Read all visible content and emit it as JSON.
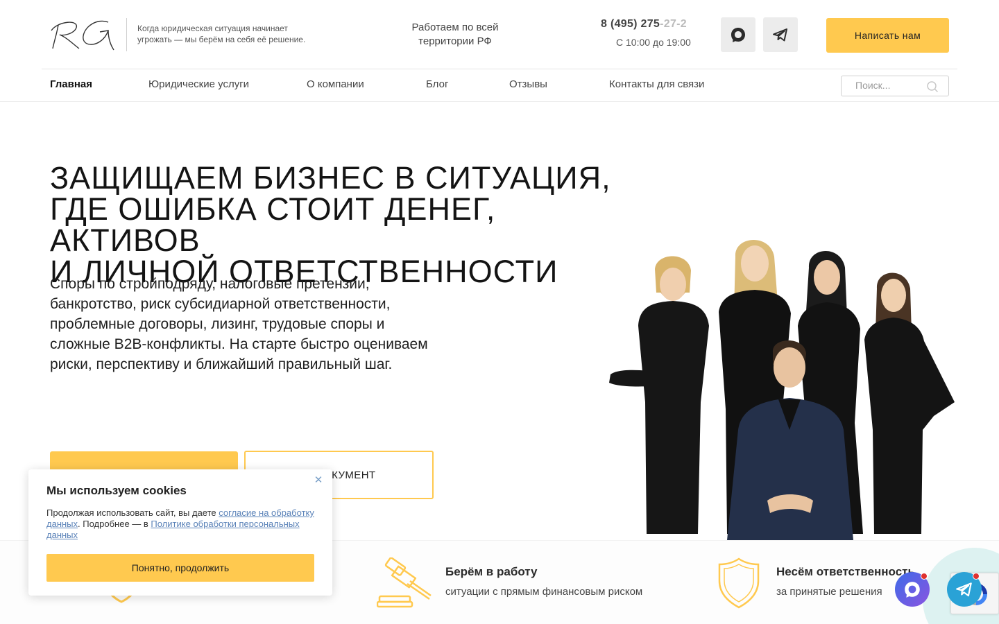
{
  "header": {
    "logo_text": "RG",
    "tagline": "Когда юридическая ситуация начинает угрожать — мы берём на себя её решение.",
    "region": "Работаем по всей территории РФ",
    "phone_main": "8 (495) 275",
    "phone_tail": "-27-2",
    "hours": "С 10:00 до 19:00",
    "messengers": [
      {
        "name": "MAX",
        "icon": "max-chat-icon"
      },
      {
        "name": "Telegram",
        "icon": "telegram-icon"
      }
    ],
    "cta_label": "Написать нам"
  },
  "nav": {
    "items": [
      {
        "label": "Главная",
        "active": true
      },
      {
        "label": "Юридические услуги",
        "active": false
      },
      {
        "label": "О компании",
        "active": false
      },
      {
        "label": "Блог",
        "active": false
      },
      {
        "label": "Отзывы",
        "active": false
      },
      {
        "label": "Контакты для связи",
        "active": false
      }
    ],
    "search_placeholder": "Поиск..."
  },
  "hero": {
    "title_lines": [
      "ЗАЩИЩАЕМ БИЗНЕС В СИТУАЦИЯ,",
      "ГДЕ ОШИБКА СТОИТ ДЕНЕГ, АКТИВОВ",
      "И ЛИЧНОЙ ОТВЕТСТВЕННОСТИ"
    ],
    "subtitle": "Споры по стройподряду, налоговые претензии, банкротство, риск субсидиарной ответственности, проблемные договоры, лизинг, трудовые споры и сложные B2B-конфликты. На старте быстро оцениваем риски, перспективу и ближайший правильный шаг.",
    "primary_button_label": "",
    "secondary_button_label": "ть ДОКУМЕНТ"
  },
  "features": [
    {
      "icon": "shield-outline-icon",
      "title": "",
      "text": ""
    },
    {
      "icon": "gavel-icon",
      "title": "Берём в работу",
      "text": "ситуации с прямым финансовым риском"
    },
    {
      "icon": "shield-icon",
      "title": "Несём ответственность",
      "text": "за принятые решения"
    }
  ],
  "cookie": {
    "title": "Мы используем cookies",
    "text_before": "Продолжая использовать сайт, вы даете ",
    "link_consent": "согласие на обработку данных",
    "text_middle": ". Подробнее — в ",
    "link_policy": "Политике обработки персональных данных",
    "button_label": "Понятно, продолжить",
    "close_symbol": "✕"
  },
  "colors": {
    "accent": "#ffc94f",
    "text": "#1d1d1d",
    "link": "#5a82b8",
    "telegram": "#2aa2d6"
  }
}
